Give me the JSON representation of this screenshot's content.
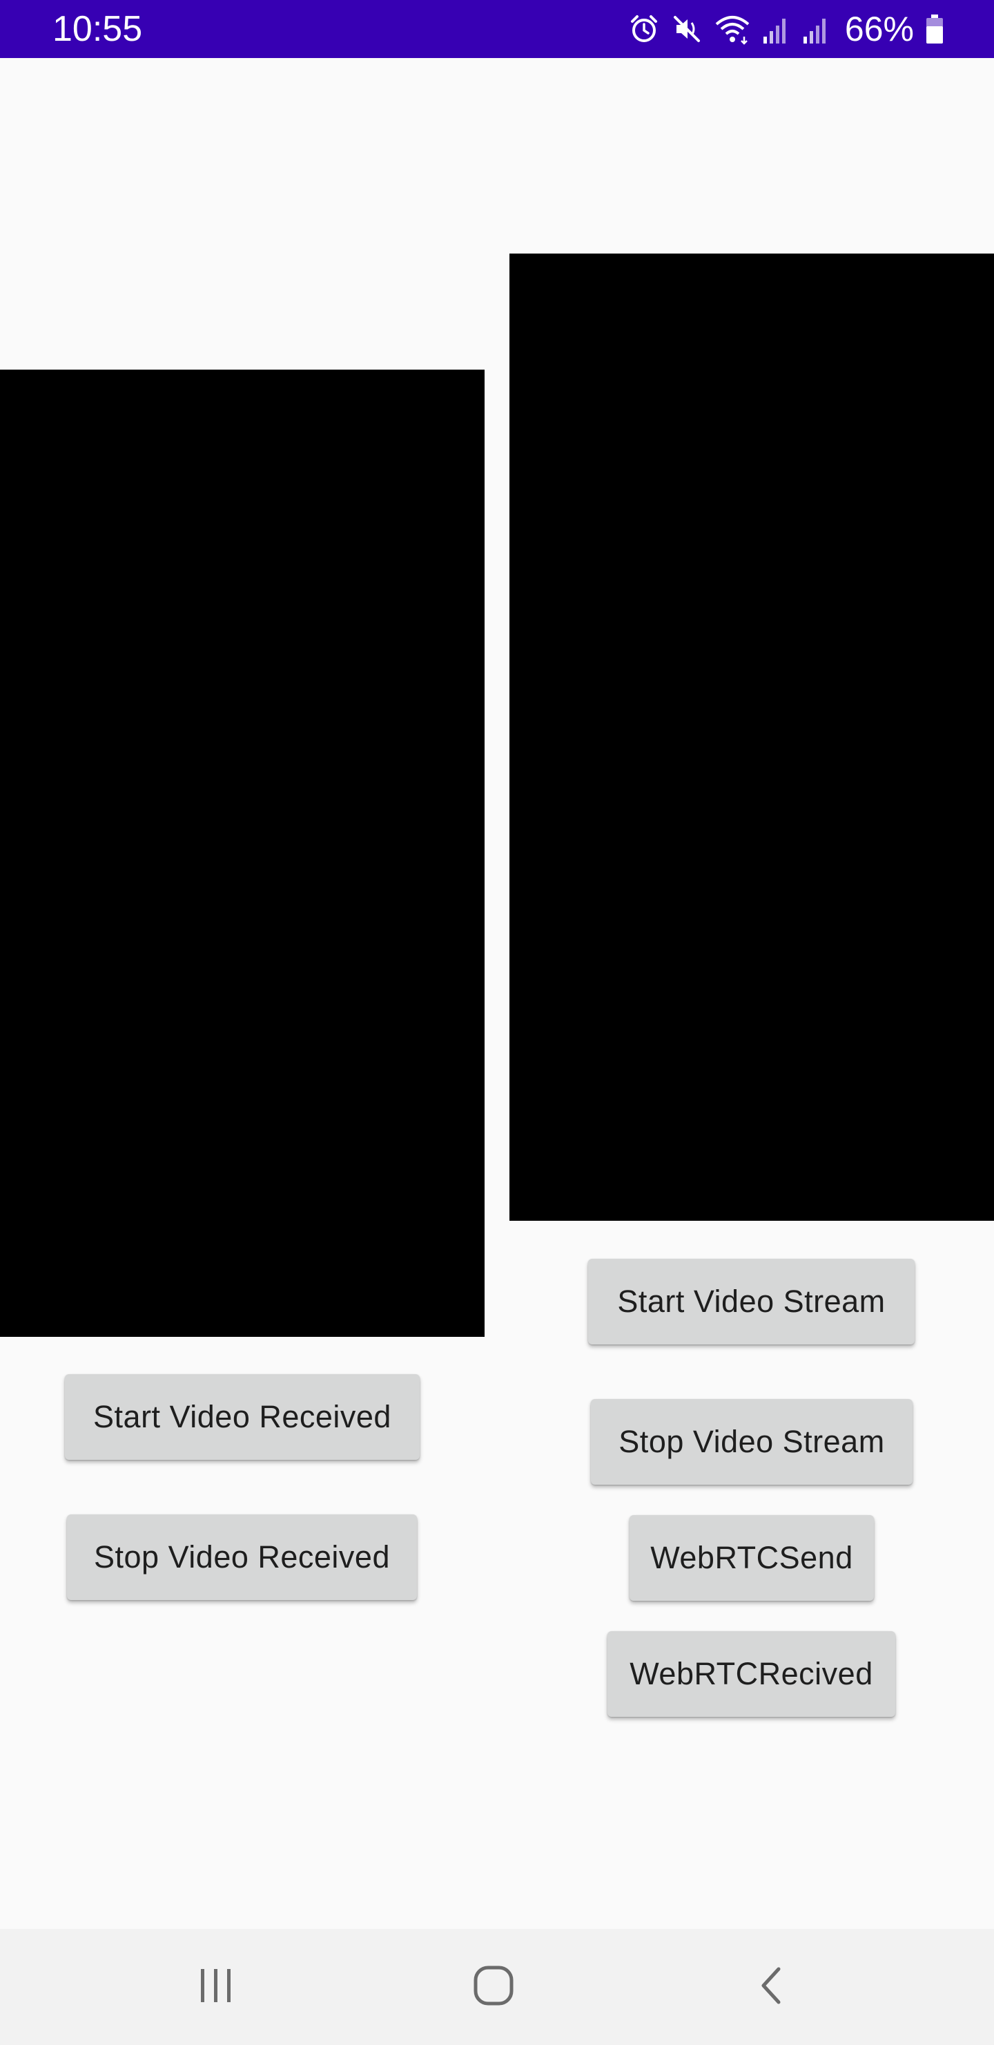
{
  "status_bar": {
    "time": "10:55",
    "battery_percent": "66%",
    "icons": [
      "alarm-icon",
      "mute-icon",
      "wifi-icon",
      "signal-icon",
      "signal-icon",
      "battery-icon"
    ],
    "background_color": "#3700b3"
  },
  "left_panel": {
    "video_surface": "video-received-view",
    "buttons": {
      "start_received": "Start Video Received",
      "stop_received": "Stop Video Received"
    }
  },
  "right_panel": {
    "video_surface": "video-stream-view",
    "buttons": {
      "start_stream": "Start Video Stream",
      "stop_stream": "Stop Video Stream",
      "webrtc_send": "WebRTCSend",
      "webrtc_received": "WebRTCRecived"
    }
  },
  "navigation_bar": {
    "items": [
      "recent-apps-icon",
      "home-icon",
      "back-icon"
    ]
  },
  "colors": {
    "button_background": "#d6d7d7",
    "page_background": "#fafafa",
    "video_background": "#000000"
  }
}
